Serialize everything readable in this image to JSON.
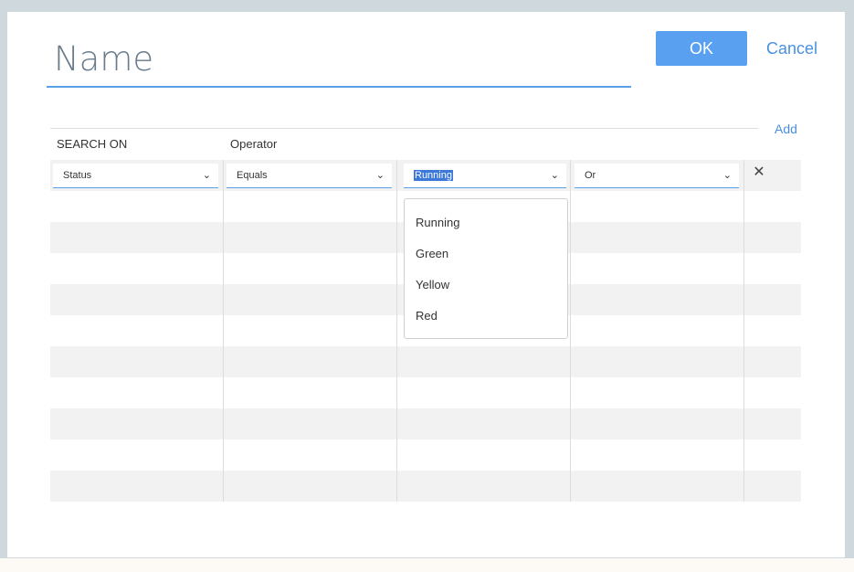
{
  "dialog": {
    "name_placeholder": "Name",
    "ok_label": "OK",
    "cancel_label": "Cancel",
    "add_label": "Add"
  },
  "table": {
    "headers": {
      "search_on": "SEARCH ON",
      "operator": "Operator"
    },
    "row1": {
      "field": "Status",
      "operator": "Equals",
      "value": "Running",
      "logic": "Or"
    }
  },
  "dropdown": {
    "options": [
      "Running",
      "Green",
      "Yellow",
      "Red"
    ]
  },
  "icons": {
    "chevron": "chevron-down-icon",
    "remove": "close-icon"
  },
  "colors": {
    "accent": "#5aa0f0",
    "link": "#4a90e2",
    "selection": "#3b78d8"
  }
}
